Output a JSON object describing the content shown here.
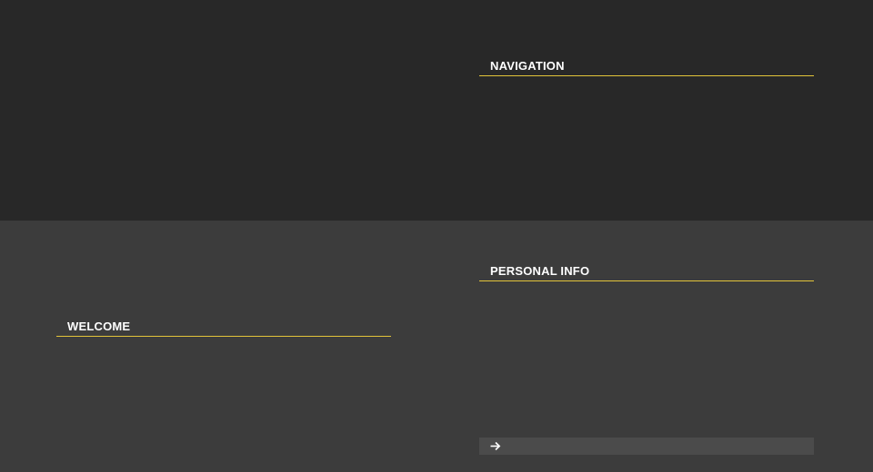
{
  "sections": {
    "navigation": {
      "title": "NAVIGATION"
    },
    "personal_info": {
      "title": "PERSONAL INFO"
    },
    "welcome": {
      "title": "WELCOME"
    }
  },
  "more_link": {
    "icon": "arrow-right-icon"
  },
  "colors": {
    "top_band": "#282828",
    "bottom_band": "#3c3c3c",
    "accent_underline": "#e3c43a",
    "more_bar": "#4b4b4b",
    "heading_text": "#ffffff"
  }
}
